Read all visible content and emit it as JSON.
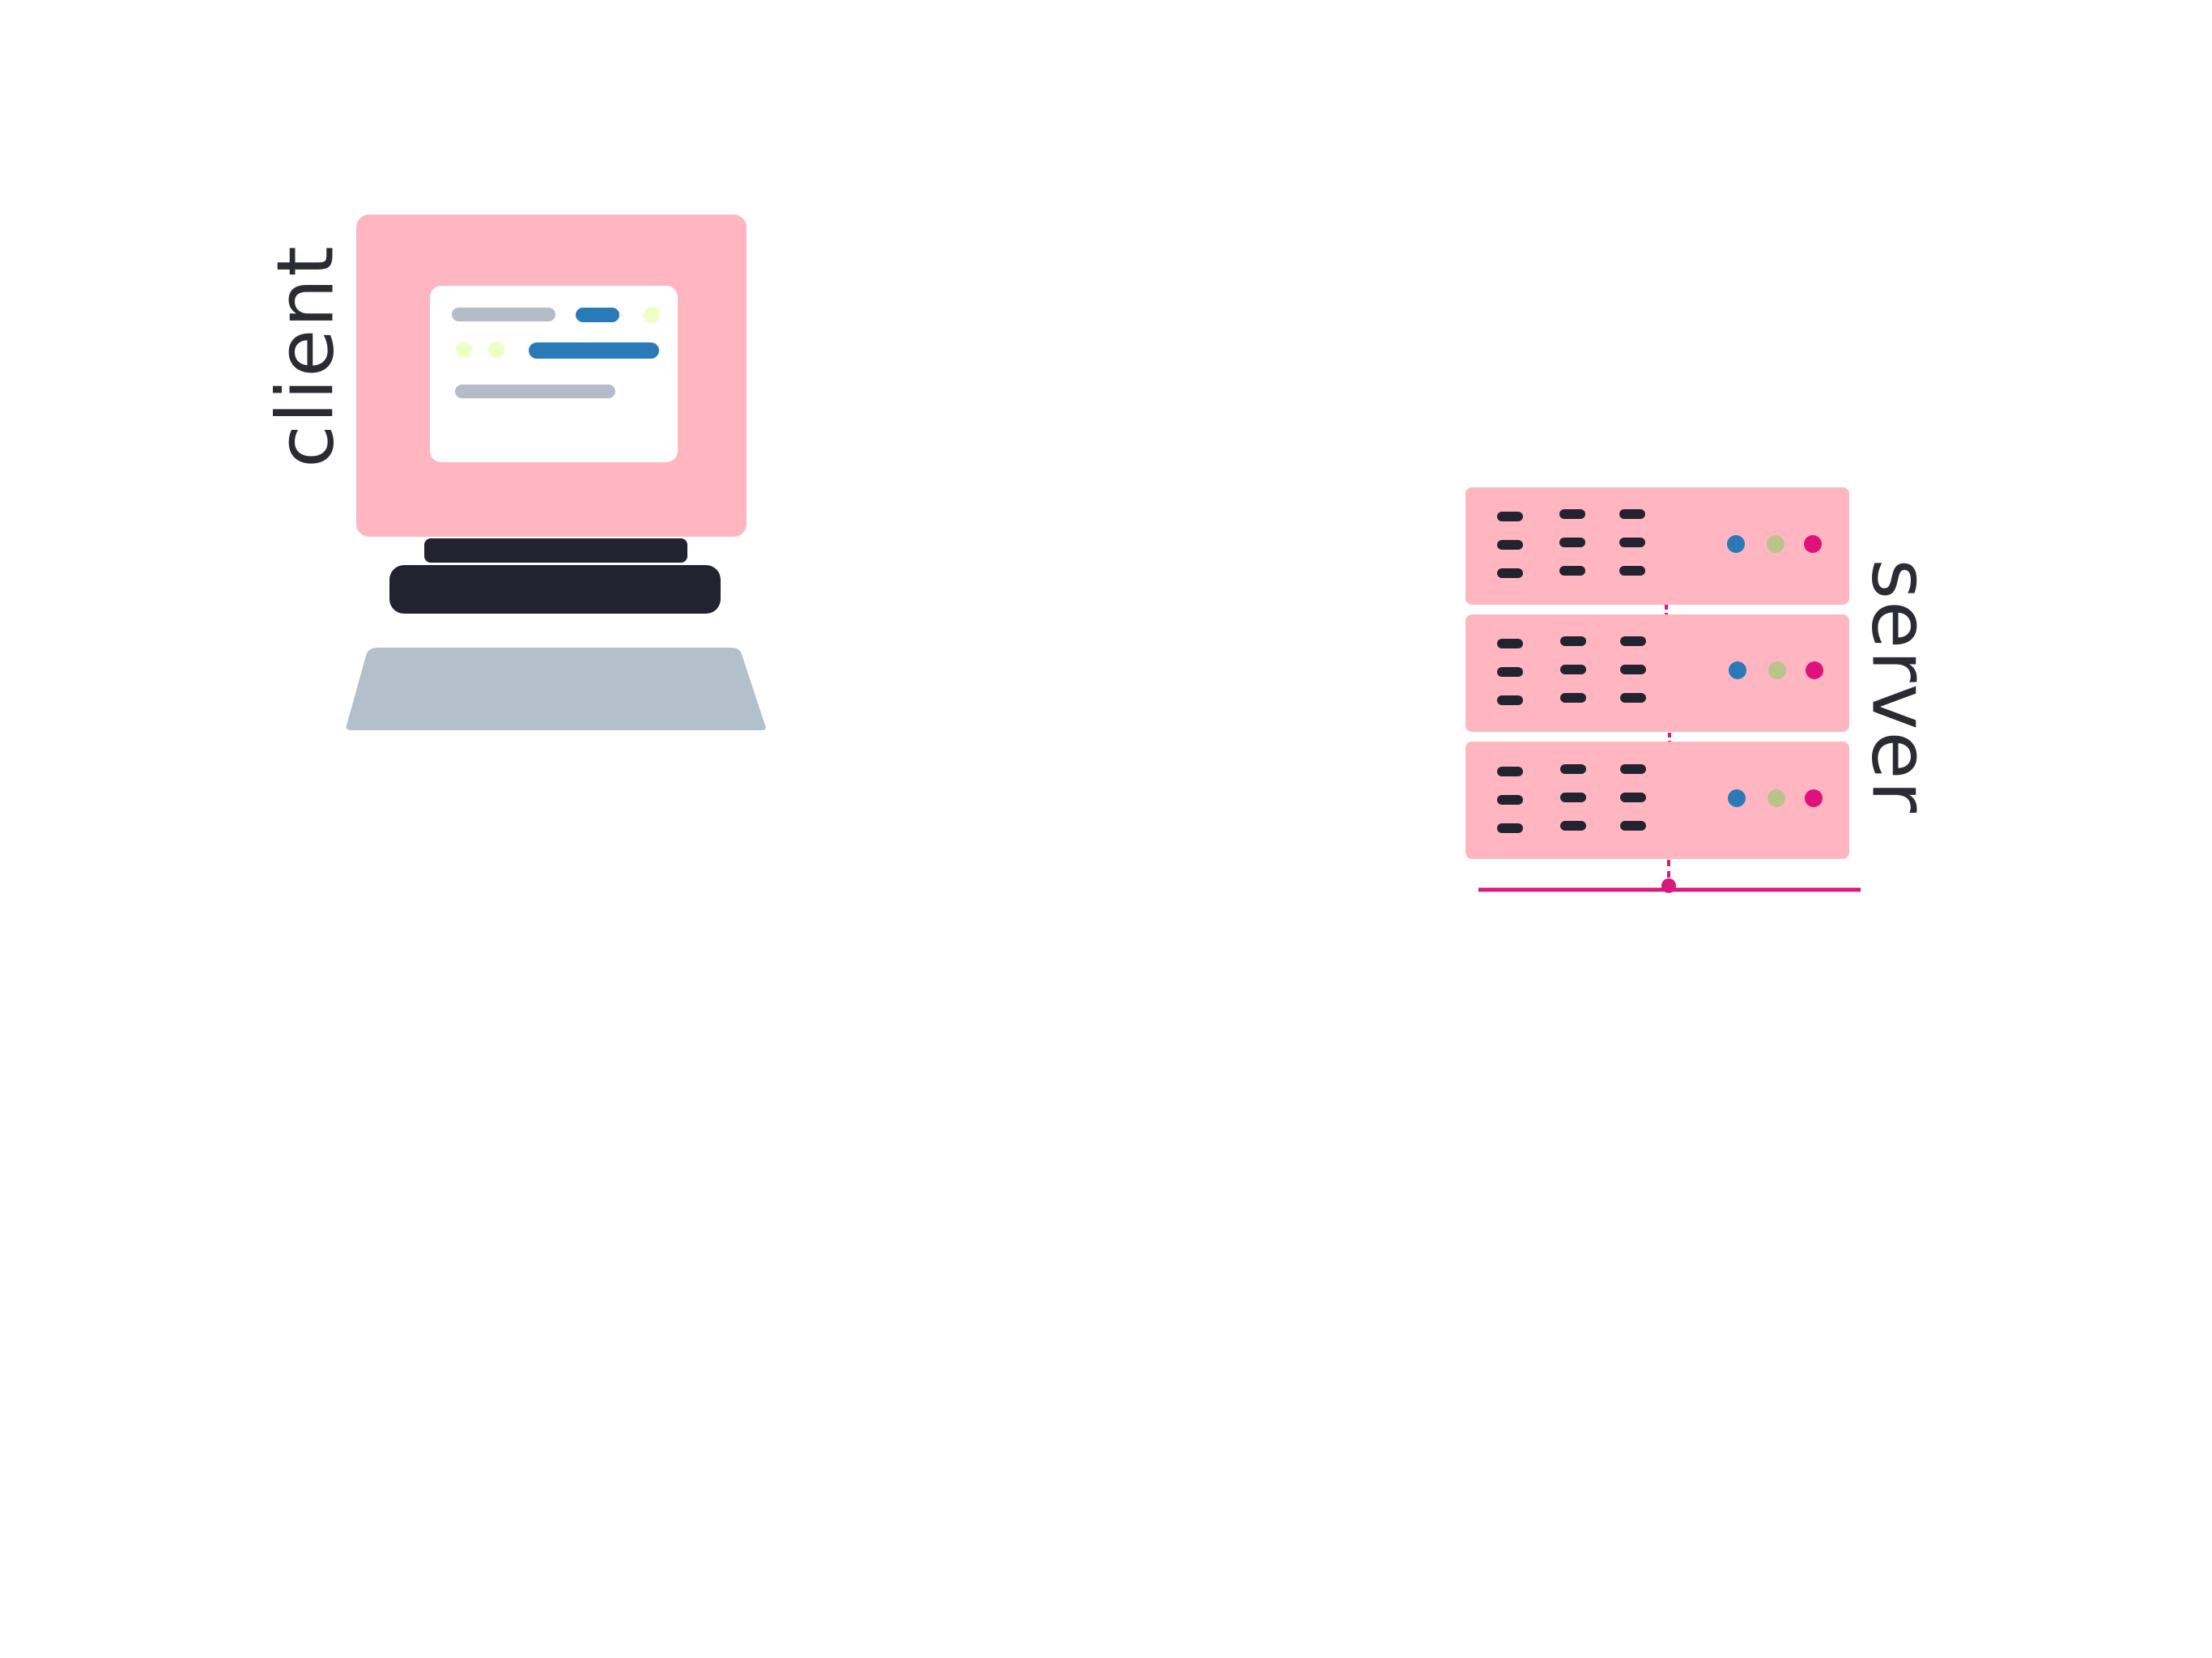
{
  "labels": {
    "client": "client",
    "server": "server"
  },
  "colors": {
    "background": "#ffffff",
    "monitor_body": "#ffb6c1",
    "monitor_screen": "#ffffff",
    "dark": "#23232f",
    "keyboard": "#b3c0cc",
    "bar_gray": "#b3bcc7",
    "bar_blue": "#2a7ab8",
    "dot_lime": "#eeffc4",
    "server_unit": "#ffb6c1",
    "led_blue": "#2a7ab8",
    "led_olive": "#b8c48c",
    "led_magenta": "#e0107c",
    "cable": "#d81b7a"
  },
  "icons": {
    "client": "desktop-computer-icon",
    "server": "server-rack-icon"
  },
  "server": {
    "unit_count": 3
  }
}
